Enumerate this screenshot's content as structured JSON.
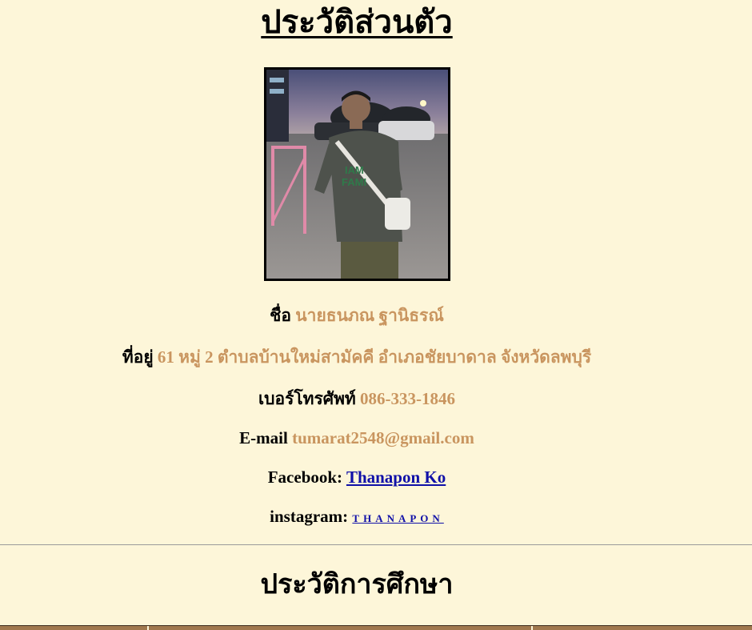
{
  "profile": {
    "title": "ประวัติส่วนตัว",
    "name_label": "ชื่อ",
    "name_value": "นายธนภณ ฐานิธรณ์",
    "address_label": "ที่อยู่",
    "address_value": "61 หมู่ 2 ตำบลบ้านใหม่สามัคคี อำเภอชัยบาดาล จังหวัดลพบุรี",
    "phone_label": "เบอร์โทรศัพท์",
    "phone_value": "086-333-1846",
    "email_label": "E-mail",
    "email_value": "tumarat2548@gmail.com",
    "facebook_label": "Facebook:",
    "facebook_link": "Thanapon Ko",
    "instagram_label": "instagram:",
    "instagram_link": "THANAPON"
  },
  "education": {
    "title": "ประวัติการศึกษา"
  },
  "colors": {
    "background": "#fdf6d9",
    "value_text": "#c9955f",
    "link": "#1010a8",
    "table_header": "#a0784e"
  },
  "icons": {
    "photo": "profile-photo"
  }
}
